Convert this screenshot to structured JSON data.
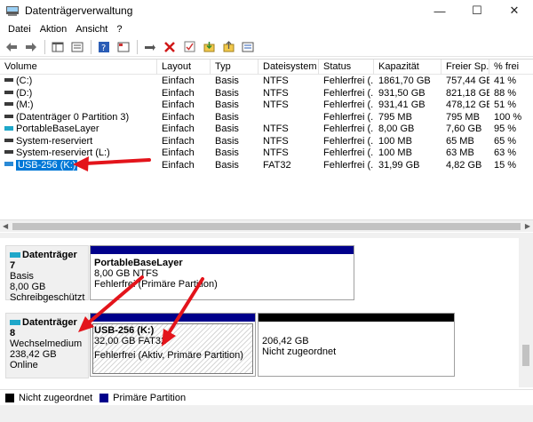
{
  "window": {
    "title": "Datenträgerverwaltung",
    "minimize": "—",
    "maximize": "☐",
    "close": "✕"
  },
  "menu": {
    "items": [
      "Datei",
      "Aktion",
      "Ansicht",
      "?"
    ]
  },
  "table": {
    "columns": [
      "Volume",
      "Layout",
      "Typ",
      "Dateisystem",
      "Status",
      "Kapazität",
      "Freier Sp...",
      "% frei"
    ],
    "rows": [
      {
        "volume": "(C:)",
        "layout": "Einfach",
        "typ": "Basis",
        "fs": "NTFS",
        "status": "Fehlerfrei (...",
        "kap": "1861,70 GB",
        "frei": "757,44 GB",
        "pct": "41 %",
        "icon": "drive-icon"
      },
      {
        "volume": "(D:)",
        "layout": "Einfach",
        "typ": "Basis",
        "fs": "NTFS",
        "status": "Fehlerfrei (...",
        "kap": "931,50 GB",
        "frei": "821,18 GB",
        "pct": "88 %",
        "icon": "drive-icon"
      },
      {
        "volume": "(M:)",
        "layout": "Einfach",
        "typ": "Basis",
        "fs": "NTFS",
        "status": "Fehlerfrei (...",
        "kap": "931,41 GB",
        "frei": "478,12 GB",
        "pct": "51 %",
        "icon": "drive-icon"
      },
      {
        "volume": "(Datenträger 0 Partition 3)",
        "layout": "Einfach",
        "typ": "Basis",
        "fs": "",
        "status": "Fehlerfrei (...",
        "kap": "795 MB",
        "frei": "795 MB",
        "pct": "100 %",
        "icon": "drive-icon"
      },
      {
        "volume": "PortableBaseLayer",
        "layout": "Einfach",
        "typ": "Basis",
        "fs": "NTFS",
        "status": "Fehlerfrei (...",
        "kap": "8,00 GB",
        "frei": "7,60 GB",
        "pct": "95 %",
        "icon": "portable-drive-icon"
      },
      {
        "volume": "System-reserviert",
        "layout": "Einfach",
        "typ": "Basis",
        "fs": "NTFS",
        "status": "Fehlerfrei (...",
        "kap": "100 MB",
        "frei": "65 MB",
        "pct": "65 %",
        "icon": "drive-icon"
      },
      {
        "volume": "System-reserviert (L:)",
        "layout": "Einfach",
        "typ": "Basis",
        "fs": "NTFS",
        "status": "Fehlerfrei (...",
        "kap": "100 MB",
        "frei": "63 MB",
        "pct": "63 %",
        "icon": "drive-icon"
      },
      {
        "volume": "USB-256 (K:)",
        "layout": "Einfach",
        "typ": "Basis",
        "fs": "FAT32",
        "status": "Fehlerfrei (...",
        "kap": "31,99 GB",
        "frei": "4,82 GB",
        "pct": "15 %",
        "icon": "usb-drive-icon",
        "selected": true
      }
    ]
  },
  "disks": {
    "disk7": {
      "name": "Datenträger 7",
      "type": "Basis",
      "size": "8,00 GB",
      "state": "Schreibgeschützt",
      "partition": {
        "name": "PortableBaseLayer",
        "size": "8,00 GB NTFS",
        "status": "Fehlerfrei (Primäre Partition)"
      }
    },
    "disk8": {
      "name": "Datenträger 8",
      "type": "Wechselmedium",
      "size": "238,42 GB",
      "state": "Online",
      "partition": {
        "name": "USB-256  (K:)",
        "size": "32,00 GB FAT32",
        "status": "Fehlerfrei (Aktiv, Primäre Partition)"
      },
      "unallocated": {
        "size": "206,42 GB",
        "status": "Nicht zugeordnet"
      }
    }
  },
  "legend": {
    "unallocated": "Nicht zugeordnet",
    "primary": "Primäre Partition"
  },
  "colors": {
    "primary_partition": "#00008b",
    "unallocated": "#000000",
    "selection": "#0078d7",
    "annotation_arrow": "#e3141b"
  }
}
